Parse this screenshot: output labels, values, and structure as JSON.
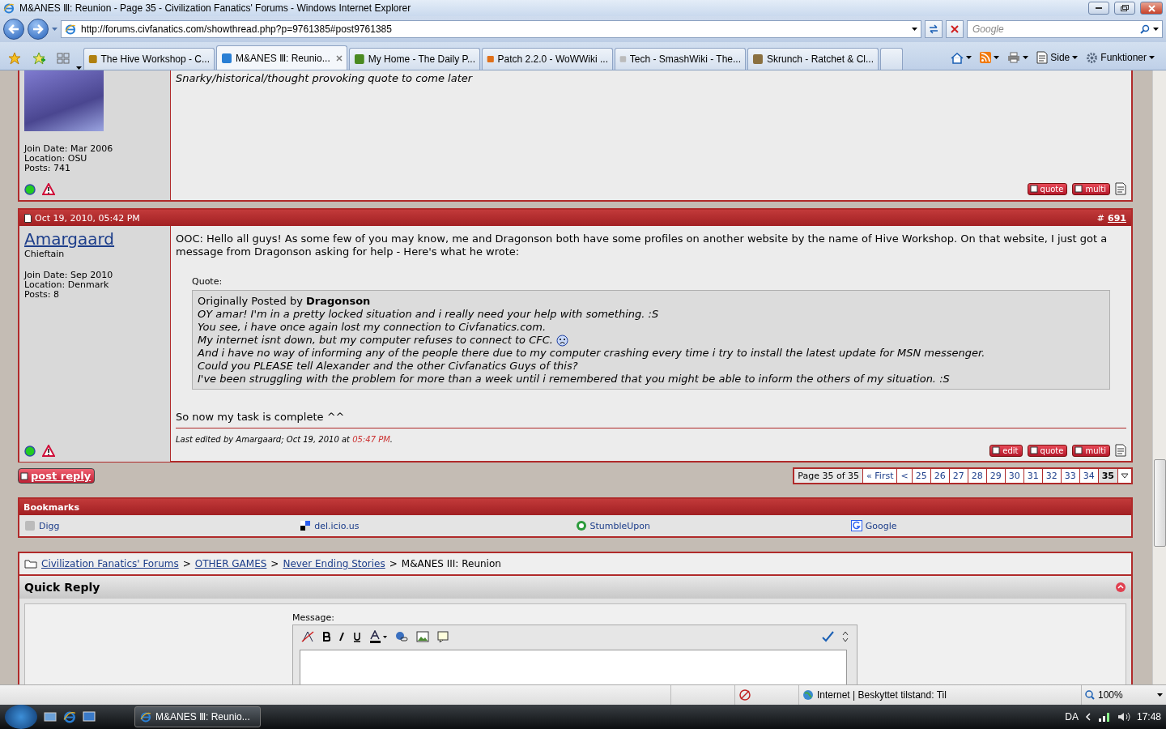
{
  "window": {
    "title": "M&ANES Ⅲ: Reunion - Page 35 - Civilization Fanatics' Forums - Windows Internet Explorer"
  },
  "address_bar": {
    "url": "http://forums.civfanatics.com/showthread.php?p=9761385#post9761385"
  },
  "search": {
    "placeholder": "Google"
  },
  "tabs": [
    {
      "label": "The Hive Workshop - C...",
      "selected": false
    },
    {
      "label": "M&ANES Ⅲ: Reunio...",
      "selected": true
    },
    {
      "label": "My Home - The Daily P...",
      "selected": false
    },
    {
      "label": "Patch 2.2.0 - WoWWiki ...",
      "selected": false
    },
    {
      "label": "Tech - SmashWiki - The...",
      "selected": false
    },
    {
      "label": "Skrunch - Ratchet & Cl...",
      "selected": false
    }
  ],
  "command_bar": [
    "Side",
    "Funktioner"
  ],
  "posts": [
    {
      "user_info": [
        "Join Date: Mar 2006",
        "Location: OSU",
        "Posts: 741"
      ],
      "online": true,
      "signature": "Snarky/historical/thought provoking quote to come later",
      "buttons": [
        "quote",
        "multi"
      ]
    },
    {
      "date": "Oct 19, 2010, 05:42 PM",
      "number_prefix": "#",
      "number": "691",
      "username": "Amargaard",
      "rank": "Chieftain",
      "user_info": [
        "Join Date: Sep 2010",
        "Location: Denmark",
        "Posts: 8"
      ],
      "online": true,
      "body": "OOC: Hello all guys! As some few of you may know, me and Dragonson both have some profiles on another website by the name of Hive Workshop. On that website, I just got a message from Dragonson asking for help - Here's what he wrote:",
      "quote": {
        "label": "Quote:",
        "posted_by": "Originally Posted by **Dragonson**",
        "lines": [
          {
            "text": "OY amar! I'm in a pretty locked situation and i really need your help with something. :S",
            "smiley": false
          },
          {
            "text": "You see, i have once again lost my connection to Civfanatics.com.",
            "smiley": false
          },
          {
            "text": "My internet isnt down, but my computer refuses to connect to CFC.",
            "smiley": true
          },
          {
            "text": "And i have no way of informing any of the people there due to my computer crashing every time i try to install the latest update for MSN messenger.",
            "smiley": false
          },
          {
            "text": "Could you PLEASE tell Alexander and the other Civfanatics Guys of this?",
            "smiley": false
          },
          {
            "text": "I've been struggling with the problem for more than a week until i remembered that you might be able to inform the others of my situation. :S",
            "smiley": false
          }
        ]
      },
      "closing": "So now my task is complete ^^",
      "edit_note": {
        "prefix": "Last edited by Amargaard; Oct 19, 2010 at",
        "time": "05:47 PM",
        "suffix": "."
      },
      "buttons": [
        "edit",
        "quote",
        "multi"
      ]
    }
  ],
  "post_reply": "post reply",
  "pagination": {
    "label": "Page 35 of 35",
    "pages": [
      {
        "label": "« First",
        "selected": false
      },
      {
        "label": "<",
        "selected": false
      },
      {
        "label": "25",
        "selected": false
      },
      {
        "label": "26",
        "selected": false
      },
      {
        "label": "27",
        "selected": false
      },
      {
        "label": "28",
        "selected": false
      },
      {
        "label": "29",
        "selected": false
      },
      {
        "label": "30",
        "selected": false
      },
      {
        "label": "31",
        "selected": false
      },
      {
        "label": "32",
        "selected": false
      },
      {
        "label": "33",
        "selected": false
      },
      {
        "label": "34",
        "selected": false
      },
      {
        "label": "35",
        "selected": true
      }
    ]
  },
  "bookmarks": {
    "title": "Bookmarks",
    "items": [
      {
        "kind": "digg",
        "label": "Digg"
      },
      {
        "kind": "delicious",
        "label": "del.icio.us"
      },
      {
        "kind": "stumbleupon",
        "label": "StumbleUpon"
      },
      {
        "kind": "google",
        "label": "Google"
      }
    ]
  },
  "breadcrumb": {
    "links": [
      "Civilization Fanatics' Forums",
      "OTHER GAMES",
      "Never Ending Stories"
    ],
    "separator": ">",
    "current": "M&ANES III: Reunion"
  },
  "quick_reply": {
    "title": "Quick Reply",
    "message_label": "Message:"
  },
  "status_bar": {
    "zone": "Internet | Beskyttet tilstand: Til",
    "zoom": "100%"
  },
  "taskbar": {
    "window": "M&ANES Ⅲ: Reunio...",
    "language": "DA",
    "time": "17:48"
  }
}
